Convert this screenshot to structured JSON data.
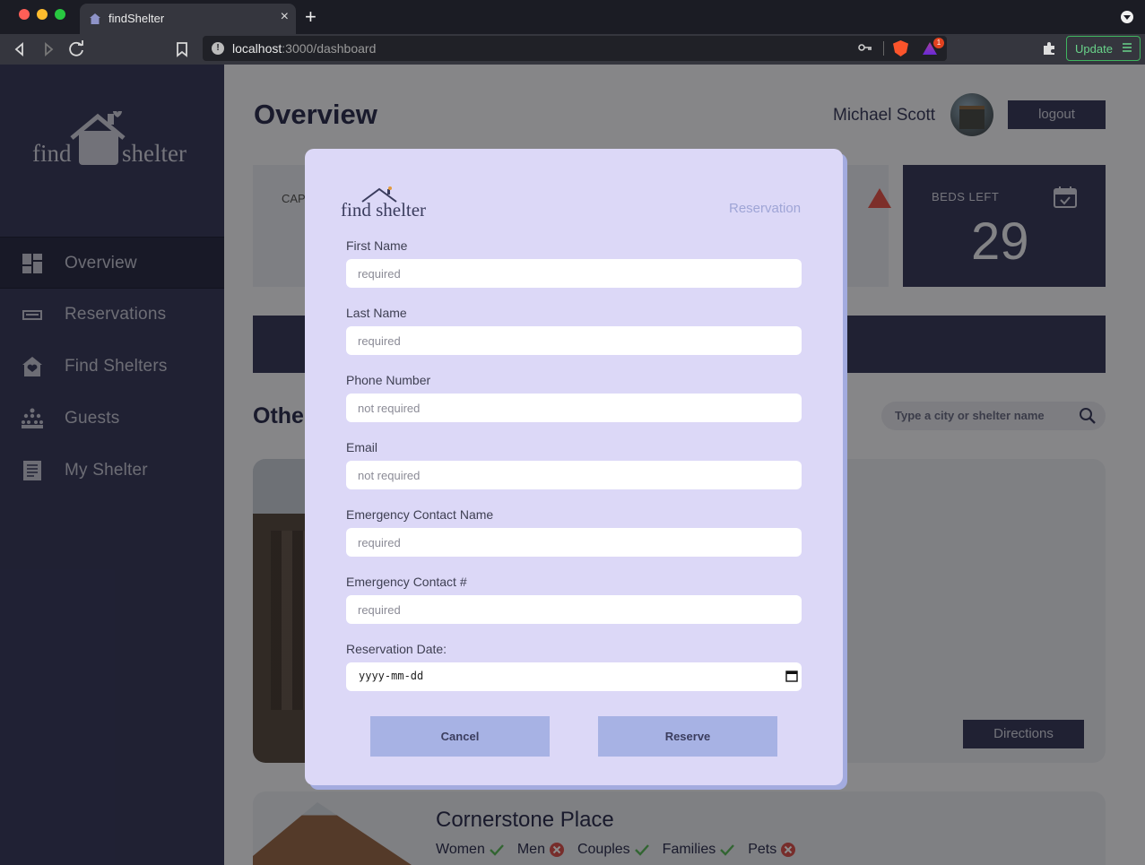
{
  "browser": {
    "tab_title": "findShelter",
    "url_host": "localhost",
    "url_path": ":3000/dashboard",
    "rewards_badge": "1",
    "update_label": "Update",
    "new_tab_symbol": "+",
    "close_tab_symbol": "×"
  },
  "sidebar": {
    "brand_left": "find",
    "brand_right": "shelter",
    "items": [
      {
        "label": "Overview",
        "icon": "dashboard-icon",
        "active": true
      },
      {
        "label": "Reservations",
        "icon": "bed-icon",
        "active": false
      },
      {
        "label": "Find Shelters",
        "icon": "house-heart-icon",
        "active": false
      },
      {
        "label": "Guests",
        "icon": "people-icon",
        "active": false
      },
      {
        "label": "My Shelter",
        "icon": "document-icon",
        "active": false
      }
    ]
  },
  "header": {
    "title": "Overview",
    "user_name": "Michael Scott",
    "logout_label": "logout"
  },
  "stats": {
    "capacity_label": "CAP",
    "beds_left_label": "BEDS LEFT",
    "beds_left_value": "29"
  },
  "others": {
    "section_title": "Other",
    "search_placeholder": "Type a city or shelter name",
    "directions_label": "Directions",
    "second_card_name": "Cornerstone Place",
    "second_card_tags": [
      {
        "label": "Women",
        "allowed": true
      },
      {
        "label": "Men",
        "allowed": false
      },
      {
        "label": "Couples",
        "allowed": true
      },
      {
        "label": "Families",
        "allowed": true
      },
      {
        "label": "Pets",
        "allowed": false
      }
    ]
  },
  "modal": {
    "logo_text": "find shelter",
    "heading": "Reservation",
    "fields": [
      {
        "label": "First Name",
        "placeholder": "required"
      },
      {
        "label": "Last Name",
        "placeholder": "required"
      },
      {
        "label": "Phone Number",
        "placeholder": "not required"
      },
      {
        "label": "Email",
        "placeholder": "not required"
      },
      {
        "label": "Emergency Contact Name",
        "placeholder": "required"
      },
      {
        "label": "Emergency Contact #",
        "placeholder": "required"
      }
    ],
    "date_label": "Reservation Date:",
    "date_placeholder": "yyyy-mm-dd",
    "cancel_label": "Cancel",
    "reserve_label": "Reserve"
  },
  "colors": {
    "sidebar": "#3b3d5e",
    "modal_bg": "#dcd8f7",
    "button": "#a7b2e4",
    "allowed": "#5cb85c",
    "denied": "#d9534f"
  }
}
